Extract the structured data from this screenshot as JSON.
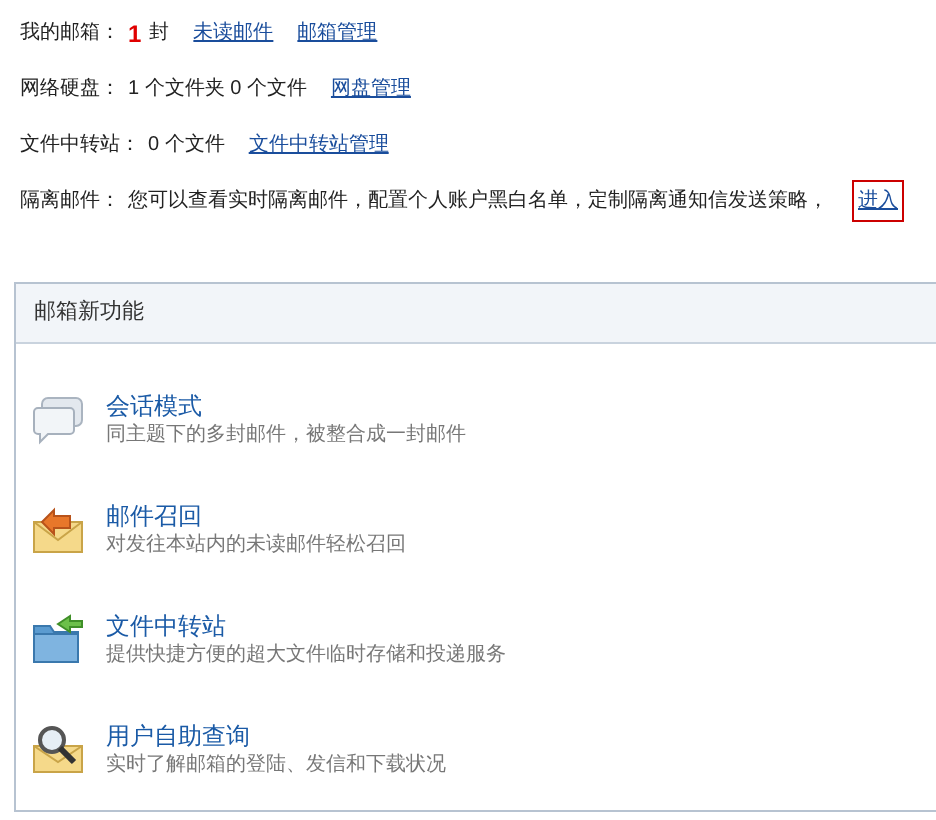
{
  "summary_rows": [
    {
      "label": "我的邮箱：",
      "parts": [
        {
          "kind": "count",
          "text": "1"
        },
        {
          "kind": "text",
          "text": "封"
        },
        {
          "kind": "link",
          "text": "未读邮件",
          "highlighted": false
        },
        {
          "kind": "link",
          "text": "邮箱管理",
          "highlighted": false
        }
      ]
    },
    {
      "label": "网络硬盘：",
      "parts": [
        {
          "kind": "text",
          "text": "1 个文件夹 0 个文件"
        },
        {
          "kind": "link",
          "text": "网盘管理",
          "highlighted": false
        }
      ]
    },
    {
      "label": "文件中转站：",
      "parts": [
        {
          "kind": "text",
          "text": "0 个文件"
        },
        {
          "kind": "link",
          "text": "文件中转站管理",
          "highlighted": false
        }
      ]
    },
    {
      "label": "隔离邮件：",
      "parts": [
        {
          "kind": "text",
          "text": "您可以查看实时隔离邮件，配置个人账户黑白名单，定制隔离通知信发送策略，"
        },
        {
          "kind": "link",
          "text": "进入",
          "highlighted": true
        }
      ]
    }
  ],
  "features_panel": {
    "title": "邮箱新功能",
    "items": [
      {
        "title": "会话模式",
        "description": "同主题下的多封邮件，被整合成一封邮件"
      },
      {
        "title": "邮件召回",
        "description": "对发往本站内的未读邮件轻松召回"
      },
      {
        "title": "文件中转站",
        "description": "提供快捷方便的超大文件临时存储和投递服务"
      },
      {
        "title": "用户自助查询",
        "description": "实时了解邮箱的登陆、发信和下载状况"
      }
    ]
  }
}
